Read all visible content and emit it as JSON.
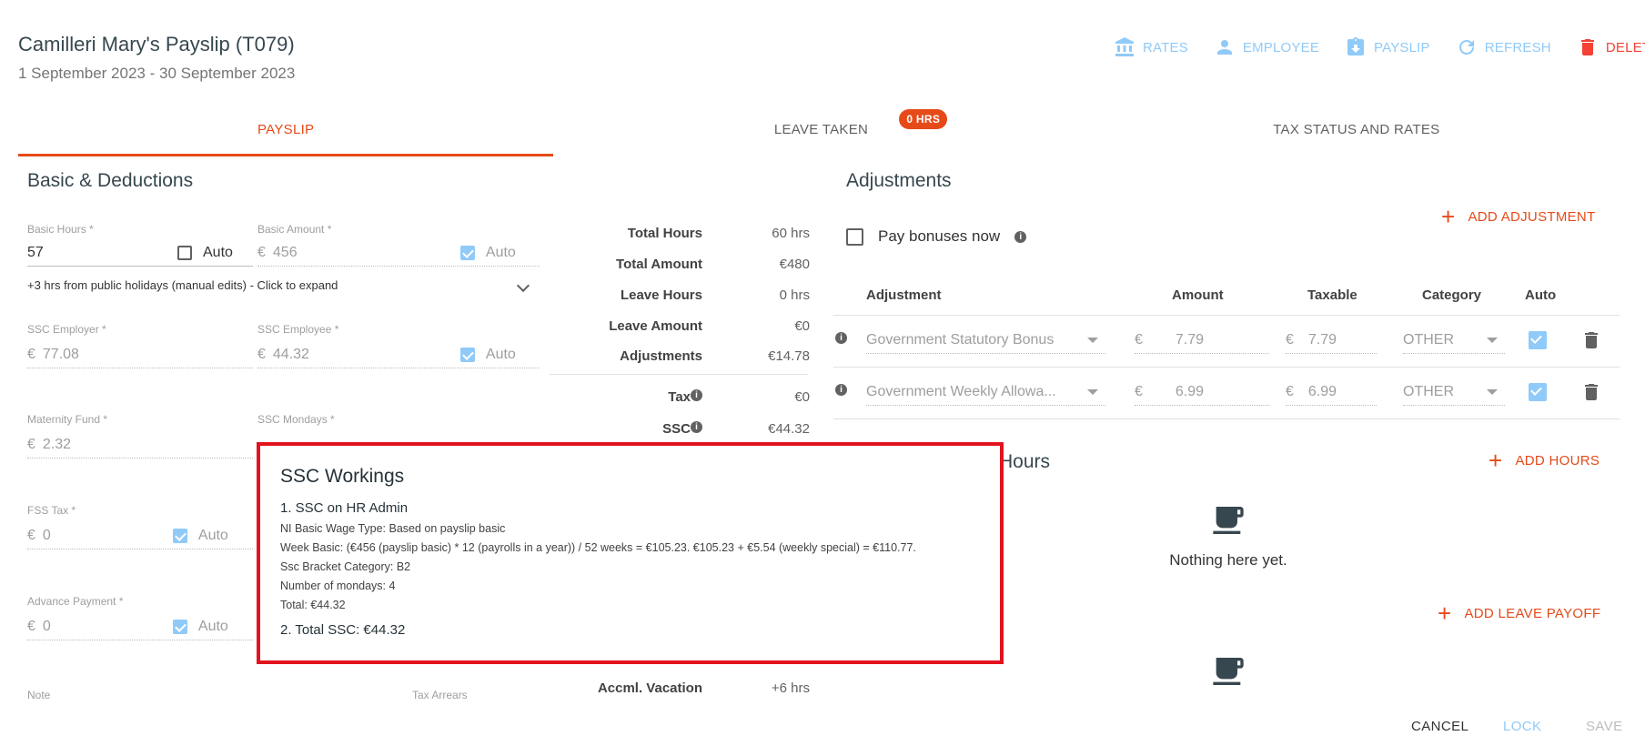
{
  "header": {
    "title": "Camilleri Mary's Payslip (T079)",
    "period": "1 September 2023 - 30 September 2023",
    "actions": {
      "rates": "RATES",
      "employee": "EMPLOYEE",
      "payslip": "PAYSLIP",
      "refresh": "REFRESH",
      "delete": "DELETE"
    }
  },
  "tabs": {
    "payslip": "PAYSLIP",
    "leave_taken": "LEAVE TAKEN",
    "leave_badge": "0 HRS",
    "tax_status": "TAX STATUS AND RATES"
  },
  "basic": {
    "heading": "Basic & Deductions",
    "basic_hours_label": "Basic Hours *",
    "basic_hours_value": "57",
    "basic_amount_label": "Basic Amount *",
    "basic_amount_value": "456",
    "currency": "€",
    "auto": "Auto",
    "holiday_note": "+3 hrs from public holidays (manual edits) - Click to expand",
    "ssc_employer_label": "SSC Employer *",
    "ssc_employer_value": "77.08",
    "ssc_employee_label": "SSC Employee *",
    "ssc_employee_value": "44.32",
    "maternity_label": "Maternity Fund *",
    "maternity_value": "2.32",
    "ssc_mondays_label": "SSC Mondays *",
    "fss_label": "FSS Tax *",
    "fss_value": "0",
    "advance_label": "Advance Payment *",
    "advance_value": "0",
    "note_label": "Note",
    "tax_arrears_label": "Tax Arrears"
  },
  "summary": {
    "total_hours_label": "Total Hours",
    "total_hours": "60 hrs",
    "total_amount_label": "Total Amount",
    "total_amount": "€480",
    "leave_hours_label": "Leave Hours",
    "leave_hours": "0 hrs",
    "leave_amount_label": "Leave Amount",
    "leave_amount": "€0",
    "adjustments_label": "Adjustments",
    "adjustments": "€14.78",
    "tax_label": "Tax",
    "tax": "€0",
    "ssc_label": "SSC",
    "ssc": "€44.32",
    "vacation_label": "Accml. Vacation",
    "vacation": "+6 hrs"
  },
  "adjustments": {
    "heading": "Adjustments",
    "add_label": "ADD ADJUSTMENT",
    "bonus_label": "Pay bonuses now",
    "columns": [
      "Adjustment",
      "Amount",
      "Taxable",
      "Category",
      "Auto"
    ],
    "rows": [
      {
        "name": "Government Statutory Bonus",
        "amount": "7.79",
        "taxable": "7.79",
        "category": "OTHER",
        "auto": true
      },
      {
        "name": "Government Weekly Allowa...",
        "amount": "6.99",
        "taxable": "6.99",
        "category": "OTHER",
        "auto": true
      }
    ]
  },
  "hours": {
    "heading_fragment": "Hours",
    "add_hours": "ADD HOURS",
    "empty": "Nothing here yet.",
    "add_leave_payoff": "ADD LEAVE PAYOFF"
  },
  "popup": {
    "title": "SSC Workings",
    "section1": "1. SSC on HR Admin",
    "lines": [
      "NI Basic Wage Type: Based on payslip basic",
      "Week Basic: (€456 (payslip basic) * 12 (payrolls in a year)) / 52 weeks = €105.23. €105.23 + €5.54 (weekly special) = €110.77.",
      "Ssc Bracket Category: B2",
      "Number of mondays: 4",
      "Total: €44.32"
    ],
    "section2": "2. Total SSC: €44.32"
  },
  "footer": {
    "cancel": "CANCEL",
    "lock": "LOCK",
    "save": "SAVE"
  },
  "colors": {
    "accent": "#e64a19",
    "light_blue": "#90caf9",
    "delete_red": "#f44336",
    "popup_border": "#e2131e"
  }
}
